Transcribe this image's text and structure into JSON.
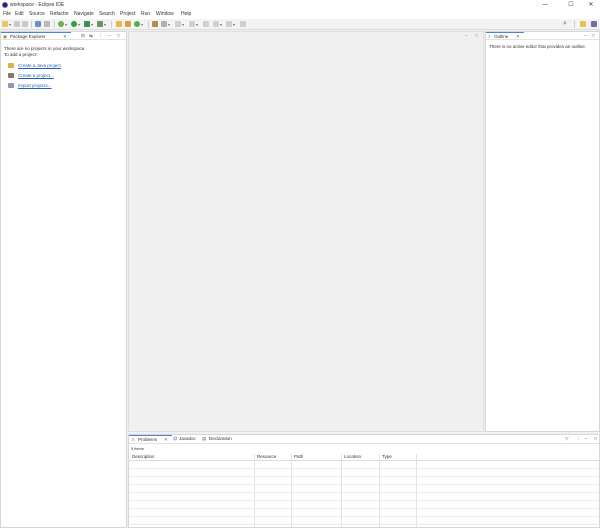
{
  "window": {
    "title": "workspace - Eclipse IDE",
    "controls": [
      "—",
      "☐",
      "✕"
    ]
  },
  "menu": [
    "File",
    "Edit",
    "Source",
    "Refactor",
    "Navigate",
    "Search",
    "Project",
    "Run",
    "Window",
    "Help"
  ],
  "package_explorer": {
    "tab_label": "Package Explorer",
    "close": "✕",
    "message_line1": "There are no projects in your workspace.",
    "message_line2": "To add a project:",
    "links": [
      "Create a Java project",
      "Create a project...",
      "Import projects..."
    ]
  },
  "outline": {
    "tab_label": "Outline",
    "close": "✕",
    "message": "There is no active editor that provides an outline."
  },
  "bottom_panel": {
    "tabs": [
      "Problems",
      "Javadoc",
      "Declaration"
    ],
    "close": "✕",
    "items_count": "0 items",
    "columns": [
      "Description",
      "Resource",
      "Path",
      "Location",
      "Type"
    ]
  },
  "colors": {
    "accent": "#1f5fb5",
    "background": "#f0f0f0",
    "panel": "#ffffff"
  }
}
